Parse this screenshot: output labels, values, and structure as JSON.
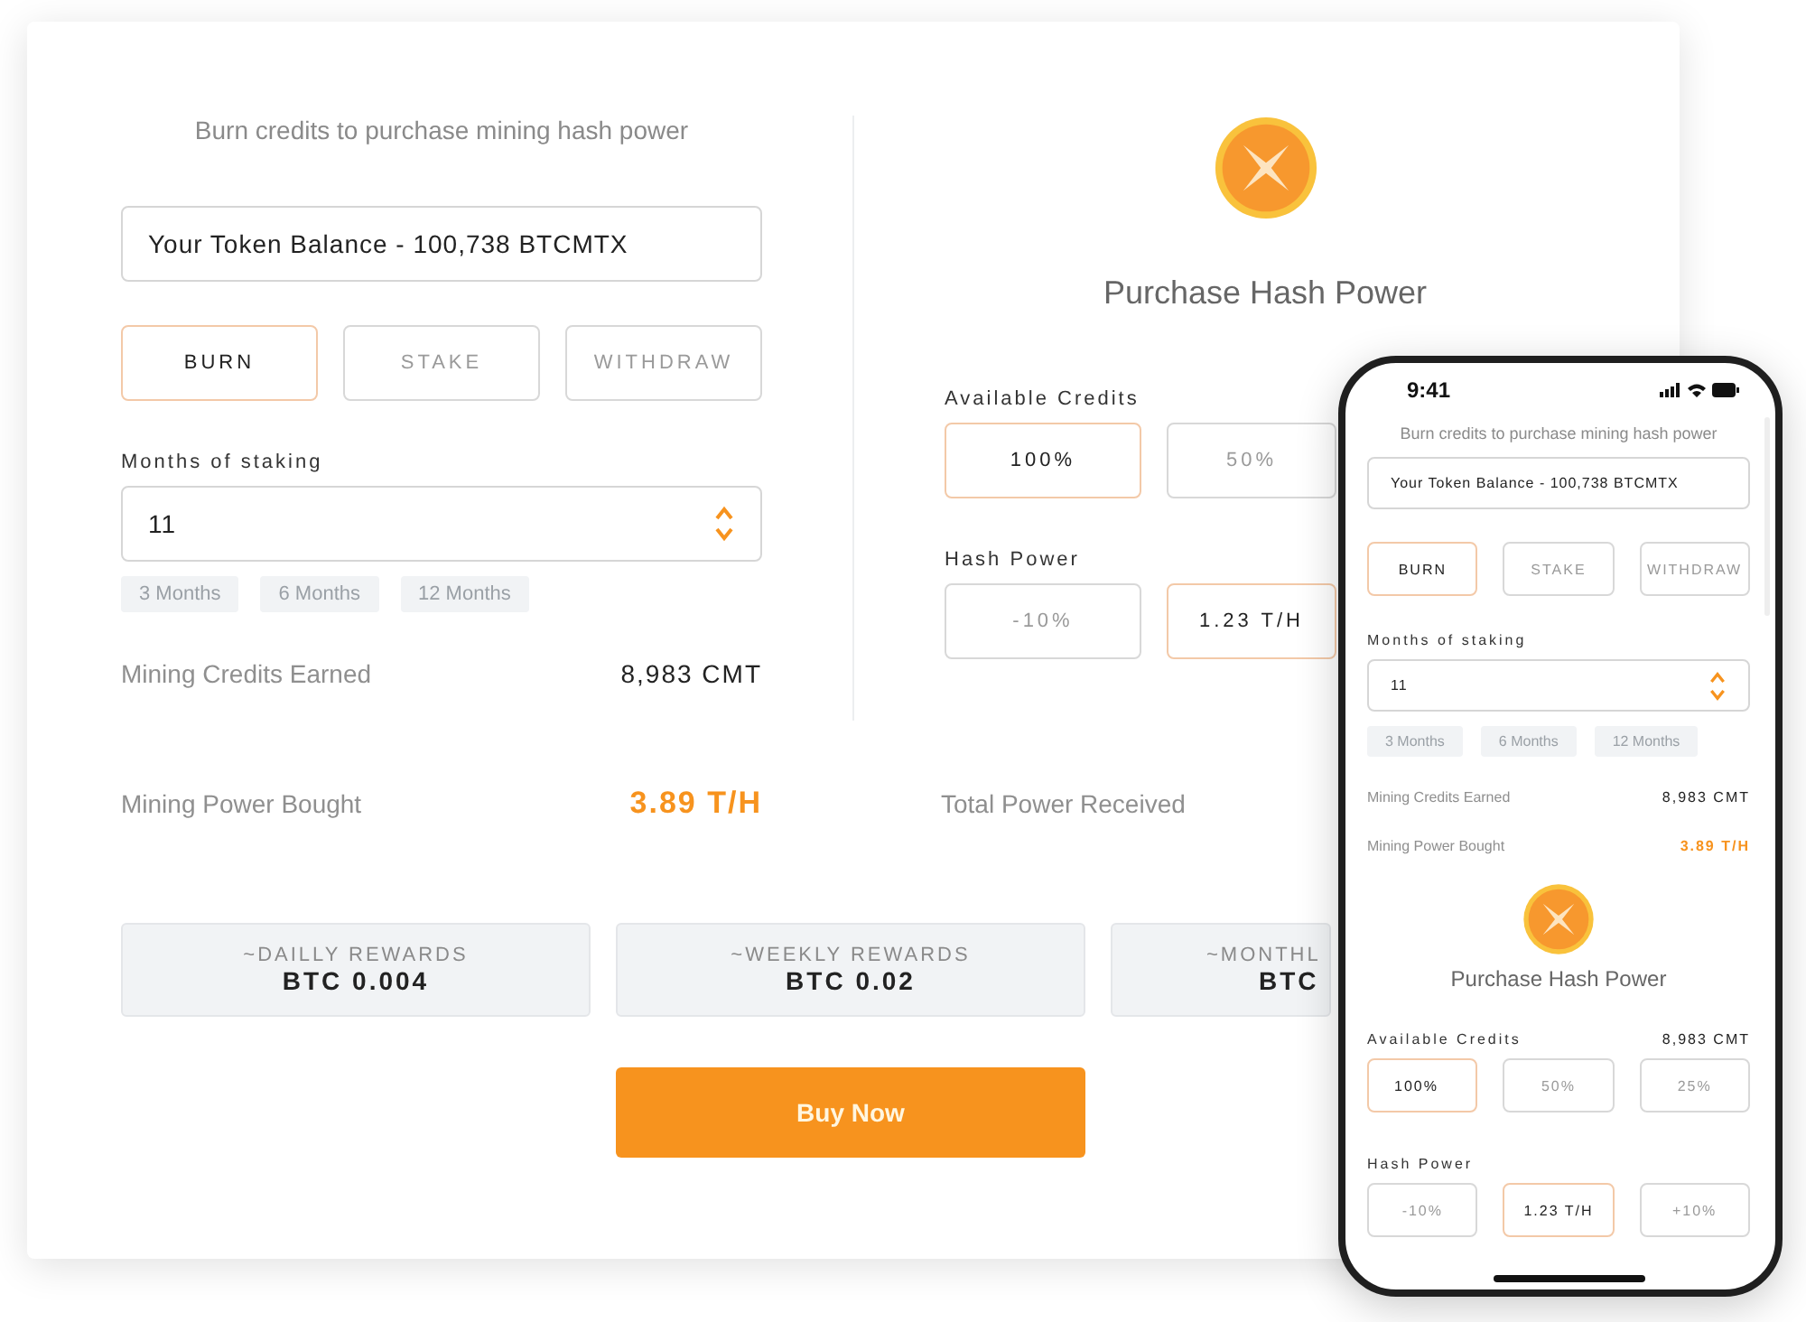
{
  "desktop": {
    "subtitle": "Burn credits to purchase mining hash power",
    "balance": "Your Token Balance - 100,738 BTCMTX",
    "modes": [
      {
        "label": "BURN",
        "selected": true
      },
      {
        "label": "STAKE",
        "selected": false
      },
      {
        "label": "WITHDRAW",
        "selected": false
      }
    ],
    "months_label": "Months of staking",
    "months_value": "11",
    "presets": [
      "3 Months",
      "6 Months",
      "12 Months"
    ],
    "credits_earned": {
      "label": "Mining Credits Earned",
      "value": "8,983 CMT"
    },
    "purchase_title": "Purchase Hash Power",
    "available_label": "Available Credits",
    "credit_options": [
      {
        "label": "100%",
        "selected": true
      },
      {
        "label": "50%",
        "selected": false
      }
    ],
    "hash_label": "Hash Power",
    "hash_options": [
      {
        "label": "-10%",
        "selected": false
      },
      {
        "label": "1.23 T/H",
        "selected": true
      }
    ],
    "power_bought": {
      "label": "Mining Power Bought",
      "value": "3.89 T/H"
    },
    "total_label": "Total Power Received",
    "rewards": [
      {
        "label": "~DAILLY REWARDS",
        "value": "BTC 0.004"
      },
      {
        "label": "~WEEKLY REWARDS",
        "value": "BTC 0.02"
      },
      {
        "label": "~MONTHL",
        "value": "BTC"
      }
    ],
    "buy_button": "Buy Now"
  },
  "phone": {
    "time": "9:41",
    "subtitle": "Burn credits to purchase mining hash power",
    "balance": "Your Token Balance - 100,738 BTCMTX",
    "modes": [
      {
        "label": "BURN",
        "selected": true
      },
      {
        "label": "STAKE",
        "selected": false
      },
      {
        "label": "WITHDRAW",
        "selected": false
      }
    ],
    "months_label": "Months of staking",
    "months_value": "11",
    "presets": [
      "3 Months",
      "6 Months",
      "12 Months"
    ],
    "credits_earned": {
      "label": "Mining Credits Earned",
      "value": "8,983 CMT"
    },
    "power_bought": {
      "label": "Mining Power Bought",
      "value": "3.89 T/H"
    },
    "purchase_title": "Purchase Hash Power",
    "available_label": "Available Credits",
    "available_value": "8,983 CMT",
    "credit_options": [
      {
        "label": "100%",
        "selected": true
      },
      {
        "label": "50%",
        "selected": false
      },
      {
        "label": "25%",
        "selected": false
      }
    ],
    "hash_label": "Hash Power",
    "hash_options": [
      {
        "label": "-10%",
        "selected": false
      },
      {
        "label": "1.23 T/H",
        "selected": true
      },
      {
        "label": "+10%",
        "selected": false
      }
    ]
  }
}
